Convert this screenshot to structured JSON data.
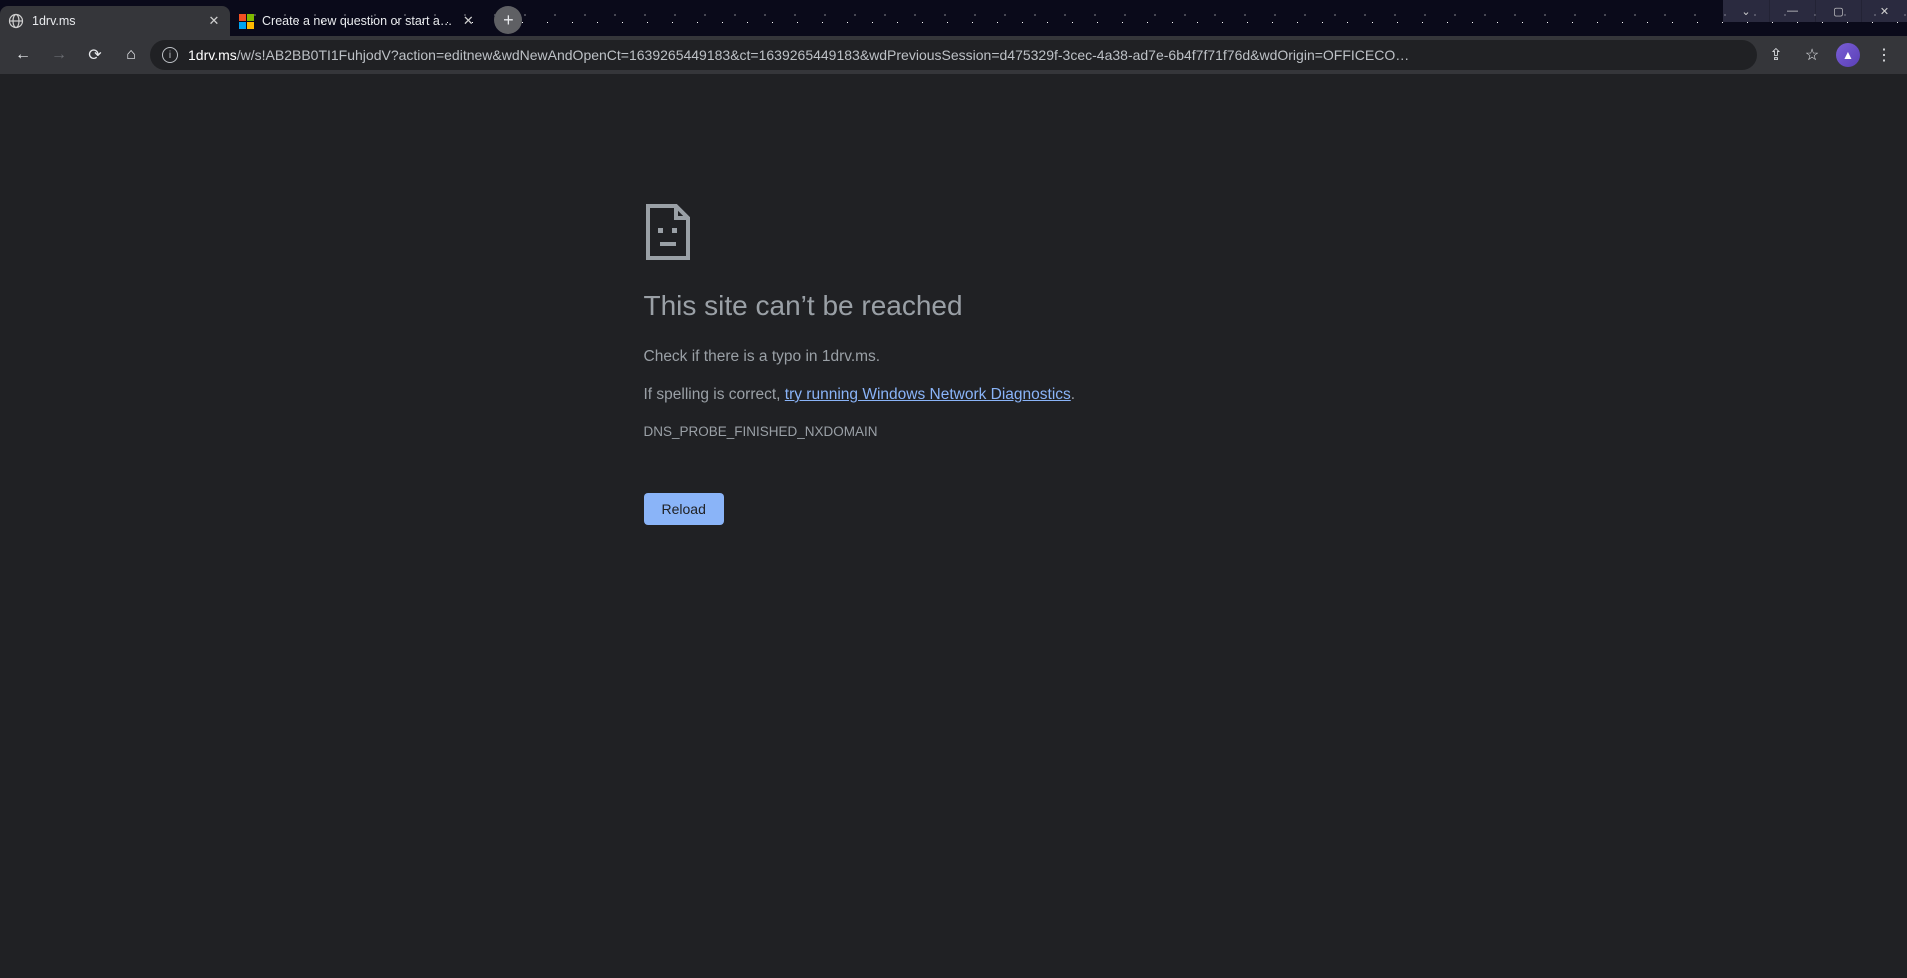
{
  "window_controls": {
    "minimize_glyph": "—",
    "maximize_glyph": "▢",
    "close_glyph": "✕",
    "chevron_glyph": "⌄"
  },
  "tabs": [
    {
      "title": "1drv.ms",
      "active": true
    },
    {
      "title": "Create a new question or start a…",
      "active": false
    }
  ],
  "newtab_glyph": "+",
  "nav": {
    "back_glyph": "←",
    "forward_glyph": "→",
    "reload_glyph": "⟳",
    "home_glyph": "⌂"
  },
  "address_bar": {
    "domain": "1drv.ms",
    "path": "/w/s!AB2BB0TI1FuhjodV?action=editnew&wdNewAndOpenCt=1639265449183&ct=1639265449183&wdPreviousSession=d475329f-3cec-4a38-ad7e-6b4f7f71f76d&wdOrigin=OFFICECO…",
    "info_glyph": "i"
  },
  "right_buttons": {
    "share_glyph": "⇪",
    "star_glyph": "☆",
    "profile_glyph": "▲",
    "menu_glyph": "⋮"
  },
  "error": {
    "title": "This site can’t be reached",
    "check_line": "Check if there is a typo in 1drv.ms.",
    "spelling_prefix": "If spelling is correct, ",
    "diag_link": "try running Windows Network Diagnostics",
    "period": ".",
    "code": "DNS_PROBE_FINISHED_NXDOMAIN",
    "reload_label": "Reload"
  }
}
